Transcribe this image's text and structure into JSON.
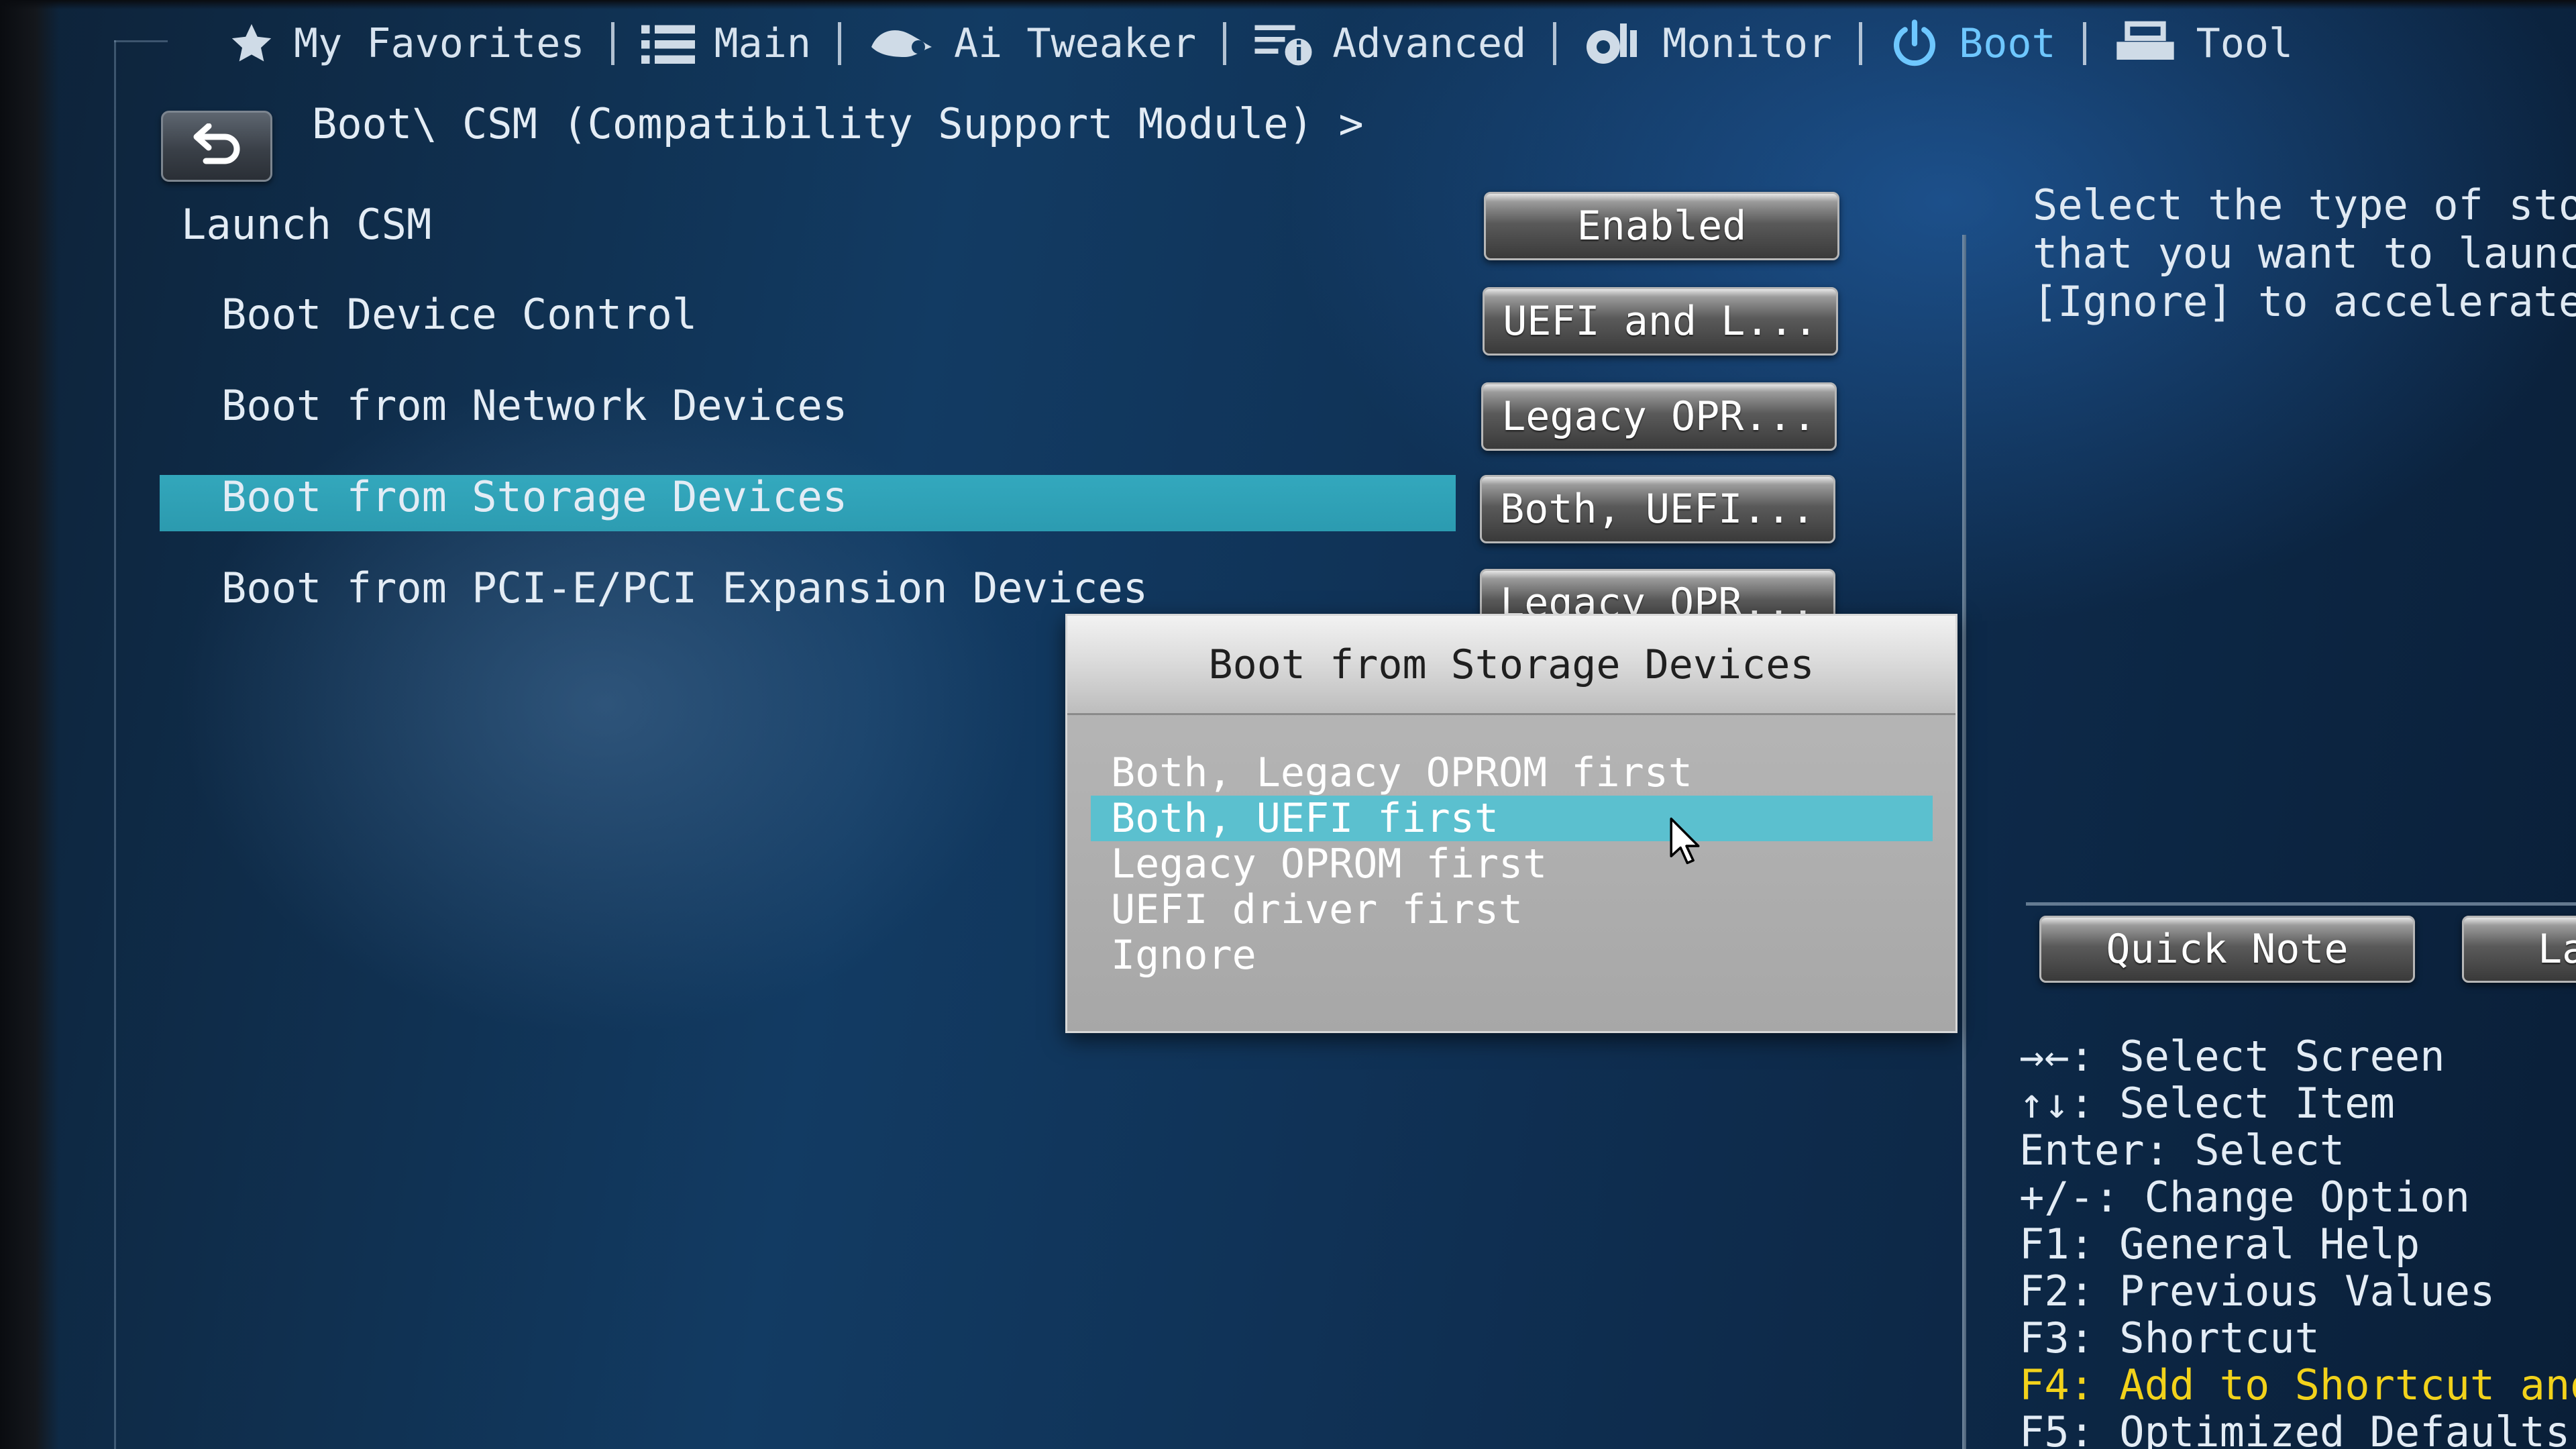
{
  "nav": {
    "items": [
      {
        "label": "My Favorites",
        "icon": "star-icon"
      },
      {
        "label": "Main",
        "icon": "list-icon"
      },
      {
        "label": "Ai Tweaker",
        "icon": "tweaker-icon"
      },
      {
        "label": "Advanced",
        "icon": "advanced-icon"
      },
      {
        "label": "Monitor",
        "icon": "monitor-icon"
      },
      {
        "label": "Boot",
        "icon": "power-icon",
        "active": true
      },
      {
        "label": "Tool",
        "icon": "tool-icon"
      }
    ],
    "active_color": "#6ec7ff"
  },
  "breadcrumb": "Boot\\ CSM (Compatibility Support Module) >",
  "settings": [
    {
      "label": "Launch CSM",
      "value": "Enabled"
    },
    {
      "label": "Boot Device Control",
      "value": "UEFI and L..."
    },
    {
      "label": "Boot from Network Devices",
      "value": "Legacy OPR..."
    },
    {
      "label": "Boot from Storage Devices",
      "value": "Both, UEFI...",
      "selected": true
    },
    {
      "label": "Boot from PCI-E/PCI Expansion Devices",
      "value": "Legacy OPR..."
    }
  ],
  "popup": {
    "title": "Boot from Storage Devices",
    "options": [
      "Both, Legacy OPROM first",
      "Both, UEFI first",
      "Legacy OPROM first",
      "UEFI driver first",
      "Ignore"
    ],
    "selected_option": "Both, UEFI first"
  },
  "help": {
    "text": "Select the type of sto\nthat you want to launch\n[Ignore] to accelerate"
  },
  "quick_buttons": {
    "quick_note": "Quick Note",
    "last_modified": "La"
  },
  "keys": [
    {
      "key": "→←",
      "desc": ": Select Screen"
    },
    {
      "key": "↑↓",
      "desc": ": Select Item"
    },
    {
      "key": "Enter",
      "desc": ": Select"
    },
    {
      "key": "+/-",
      "desc": ": Change Option"
    },
    {
      "key": "F1",
      "desc": ": General Help"
    },
    {
      "key": "F2",
      "desc": ": Previous Values"
    },
    {
      "key": "F3",
      "desc": ": Shortcut"
    },
    {
      "key": "F4",
      "desc": ": Add to Shortcut and",
      "highlight": true
    },
    {
      "key": "F5",
      "desc": ": Optimized Defaults"
    }
  ],
  "colors": {
    "highlight_row": "#36b2c6",
    "popup_selected": "#5bc0cf",
    "key_highlight": "#f2d21b"
  }
}
